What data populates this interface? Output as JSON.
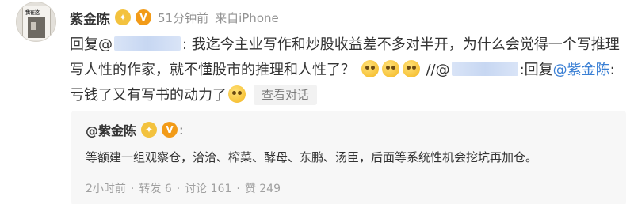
{
  "post": {
    "author": "紫金陈",
    "time": "51分钟前",
    "source": "来自iPhone",
    "reply_prefix": "回复@",
    "text_1": ": 我迄今主业写作和炒股收益差不多对半开，为什么会觉得一个写推理写人性的作家，就不懂股市的推理和人性了？",
    "slashes": " //@",
    "colon_reply": ":回复",
    "mention_self": "@紫金陈",
    "text_2": ":亏钱了又有写书的动力了",
    "view_conversation": "查看对话"
  },
  "quote": {
    "author": "@紫金陈",
    "colon": ":",
    "text": "等额建一组观察仓，洽洽、榨菜、酵母、东鹏、汤臣，后面等系统性机会挖坑再加仓。",
    "time": "2小时前",
    "repost_label": "转发 6",
    "comment_label": "讨论 161",
    "like_label": "赞 249"
  },
  "avatar_caption": "我在这",
  "badge_glyphs": {
    "gold": "✦",
    "vip": "V"
  },
  "colors": {
    "link": "#3a7fd4",
    "meta": "#939393",
    "quote_bg": "#f7f7f7"
  },
  "icons": [
    "gold-badge-icon",
    "verified-v-icon",
    "smiley-emoji-icon",
    "grin-emoji-icon"
  ]
}
